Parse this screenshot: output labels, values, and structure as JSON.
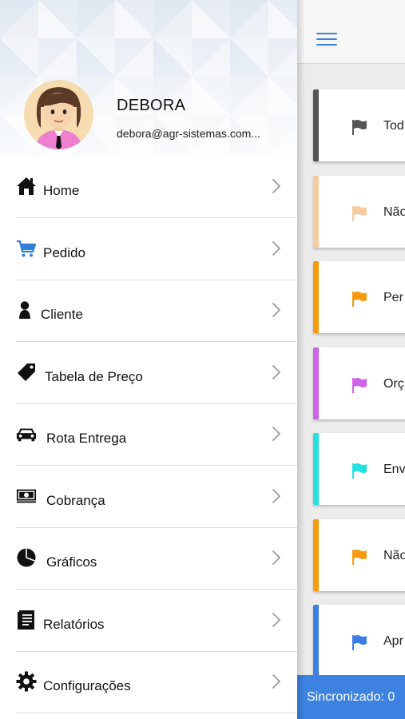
{
  "status_bar": {
    "time": ""
  },
  "drawer": {
    "user": {
      "name": "DEBORA",
      "email": "debora@agr-sistemas.com..."
    },
    "menu": [
      {
        "id": "home",
        "label": "Home",
        "icon": "home-icon"
      },
      {
        "id": "pedido",
        "label": "Pedido",
        "icon": "cart-icon"
      },
      {
        "id": "cliente",
        "label": "Cliente",
        "icon": "person-icon"
      },
      {
        "id": "tabela-preco",
        "label": "Tabela de Preço",
        "icon": "price-tag-icon"
      },
      {
        "id": "rota-entrega",
        "label": "Rota Entrega",
        "icon": "car-icon"
      },
      {
        "id": "cobranca",
        "label": "Cobrança",
        "icon": "money-icon"
      },
      {
        "id": "graficos",
        "label": "Gráficos",
        "icon": "pie-chart-icon"
      },
      {
        "id": "relatorios",
        "label": "Relatórios",
        "icon": "document-icon"
      },
      {
        "id": "configuracoes",
        "label": "Configurações",
        "icon": "gear-icon"
      }
    ]
  },
  "main": {
    "status_cards": [
      {
        "label": "Tod",
        "color": "#555555"
      },
      {
        "label": "Não",
        "color": "#f7cba0"
      },
      {
        "label": "Per",
        "color": "#f79a0e"
      },
      {
        "label": "Orç",
        "color": "#cf63e8"
      },
      {
        "label": "Env",
        "color": "#26e0e0"
      },
      {
        "label": "Não",
        "color": "#f79a0e"
      },
      {
        "label": "Apr",
        "color": "#3d7ee6"
      }
    ],
    "sync_text": "Sincronizado: 0"
  },
  "colors": {
    "accent": "#3d82e0",
    "menu_icon": "#3b82d6",
    "cart_icon": "#2f7fd8"
  }
}
